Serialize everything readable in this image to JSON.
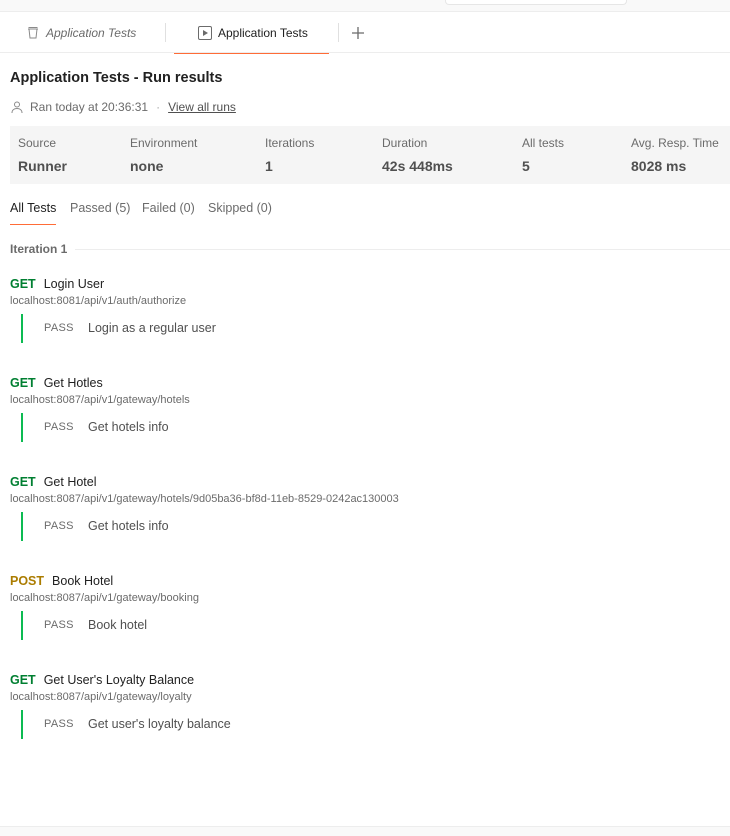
{
  "tabs": [
    {
      "label": "Application Tests",
      "icon": "collection-icon"
    },
    {
      "label": "Application Tests",
      "icon": "run-icon"
    }
  ],
  "header": {
    "title": "Application Tests - Run results",
    "ran_text": "Ran today at 20:36:31",
    "separator": "·",
    "view_all_runs": "View all runs"
  },
  "summary": [
    {
      "label": "Source",
      "value": "Runner"
    },
    {
      "label": "Environment",
      "value": "none"
    },
    {
      "label": "Iterations",
      "value": "1"
    },
    {
      "label": "Duration",
      "value": "42s 448ms"
    },
    {
      "label": "All tests",
      "value": "5"
    },
    {
      "label": "Avg. Resp. Time",
      "value": "8028 ms"
    }
  ],
  "filters": [
    {
      "label": "All Tests",
      "active": true
    },
    {
      "label": "Passed (5)"
    },
    {
      "label": "Failed (0)"
    },
    {
      "label": "Skipped (0)"
    }
  ],
  "iteration_label": "Iteration 1",
  "requests": [
    {
      "method": "GET",
      "name": "Login User",
      "url": "localhost:8081/api/v1/auth/authorize",
      "status": "PASS",
      "test": "Login as a regular user"
    },
    {
      "method": "GET",
      "name": "Get Hotles",
      "url": "localhost:8087/api/v1/gateway/hotels",
      "status": "PASS",
      "test": "Get hotels info"
    },
    {
      "method": "GET",
      "name": "Get Hotel",
      "url": "localhost:8087/api/v1/gateway/hotels/9d05ba36-bf8d-11eb-8529-0242ac130003",
      "status": "PASS",
      "test": "Get hotels info"
    },
    {
      "method": "POST",
      "name": "Book Hotel",
      "url": "localhost:8087/api/v1/gateway/booking",
      "status": "PASS",
      "test": "Book hotel"
    },
    {
      "method": "GET",
      "name": "Get User's Loyalty Balance",
      "url": "localhost:8087/api/v1/gateway/loyalty",
      "status": "PASS",
      "test": "Get user's loyalty balance"
    }
  ],
  "colors": {
    "accent": "#ff6c37",
    "get": "#007f31",
    "post": "#ab7c00",
    "pass": "#0cbb52"
  }
}
